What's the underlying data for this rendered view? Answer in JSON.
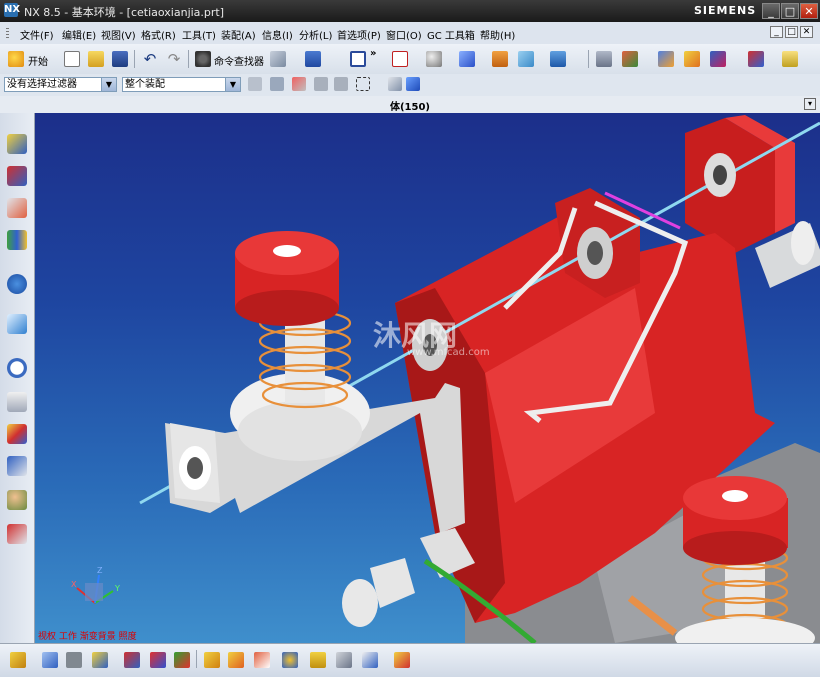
{
  "window": {
    "title": "NX 8.5 - 基本环境 - [cetiaoxianjia.prt]",
    "brand": "SIEMENS",
    "logo": "NX",
    "controls": [
      "_",
      "□",
      "✕"
    ]
  },
  "menubar": {
    "items": [
      "文件(F)",
      "编辑(E)",
      "视图(V)",
      "格式(R)",
      "工具(T)",
      "装配(A)",
      "信息(I)",
      "分析(L)",
      "首选项(P)",
      "窗口(O)",
      "GC 工具箱",
      "帮助(H)"
    ],
    "mdi_controls": [
      "_",
      "□",
      "✕"
    ]
  },
  "toolbar": {
    "start_label": "开始",
    "command_finder_label": "命令查找器",
    "more": "»"
  },
  "selection_bar": {
    "filter_value": "没有选择过滤器",
    "scope_value": "整个装配"
  },
  "cue_line": {
    "text": "体(150)"
  },
  "viewport": {
    "watermark_main": "沐风网",
    "watermark_sub": "www.mfcad.com",
    "status_text": "视权 工作 渐变背景 照度",
    "triad": {
      "x": "X",
      "y": "Y",
      "z": "Z"
    }
  },
  "colors": {
    "accent_red": "#e02828",
    "background_top": "#1c2f8a",
    "background_bottom": "#3f8fcc",
    "spring": "#e8903a",
    "wire": "#8fd8ef",
    "green_wire": "#33aa33",
    "orange_rod": "#e89048"
  }
}
